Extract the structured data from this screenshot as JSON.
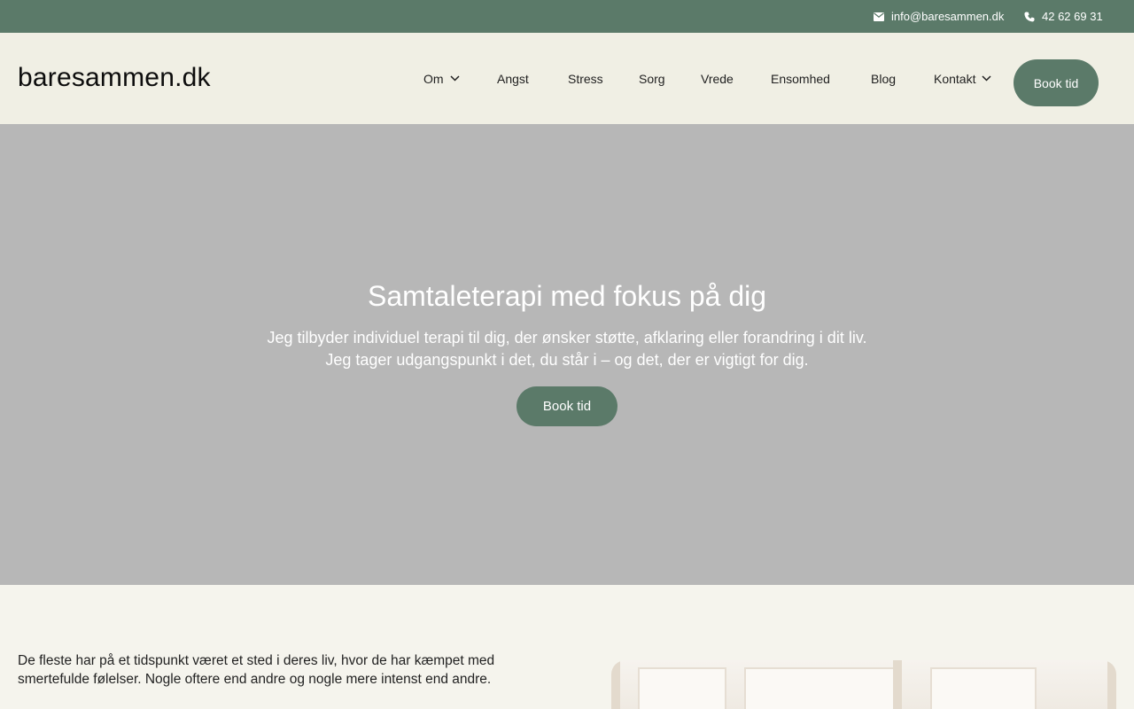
{
  "topbar": {
    "email": "info@baresammen.dk",
    "phone": "42 62 69 31"
  },
  "header": {
    "logo": "baresammen.dk",
    "nav": [
      "Om",
      "Angst",
      "Stress",
      "Sorg",
      "Vrede",
      "Ensomhed",
      "Blog",
      "Kontakt"
    ],
    "book_label": "Book tid"
  },
  "hero": {
    "title": "Samtaleterapi med fokus på dig",
    "line1": "Jeg tilbyder individuel terapi til dig, der ønsker støtte, afklaring eller forandring i dit liv.",
    "line2": "Jeg tager udgangspunkt i det, du står i – og det, der er vigtigt for dig.",
    "button": "Book tid"
  },
  "intro": {
    "text": "De fleste har på et tidspunkt været et sted i deres liv, hvor de har kæmpet med smertefulde følelser. Nogle oftere end andre og nogle mere intenst end andre."
  },
  "colors": {
    "accent": "#5b7a69",
    "header_bg": "#f0efe4",
    "hero_bg": "#b7b7b7",
    "page_bg": "#f5f4ed"
  },
  "icons": {
    "email": "envelope-icon",
    "phone": "phone-icon",
    "dropdown": "chevron-down-icon"
  }
}
